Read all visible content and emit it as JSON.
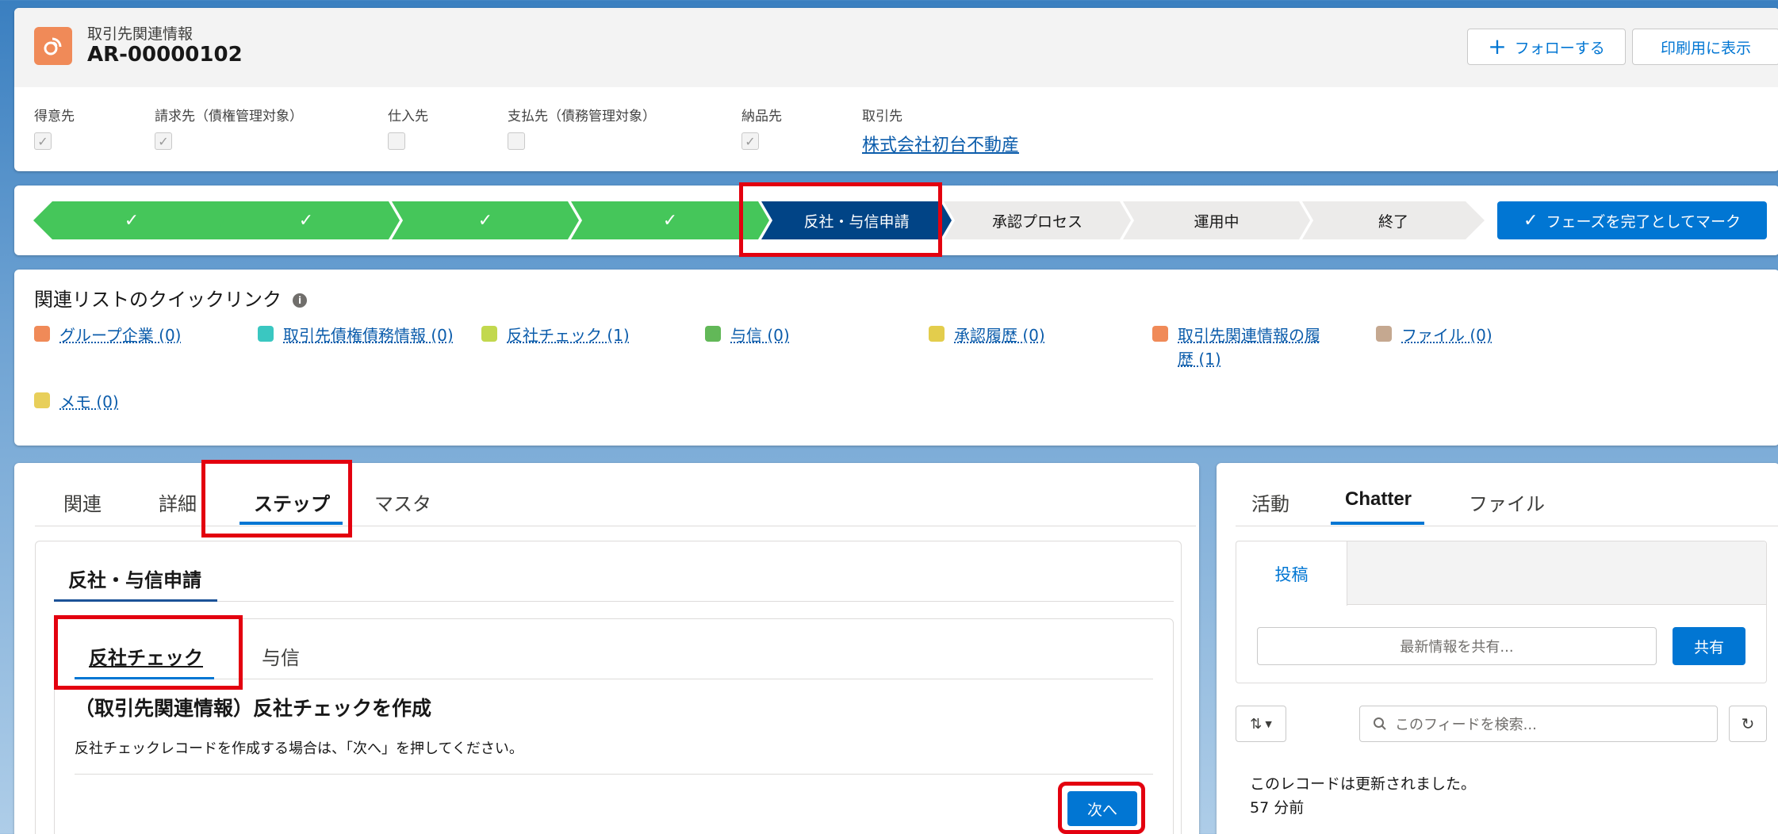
{
  "header": {
    "object_label": "取引先関連情報",
    "record_title": "AR-00000102",
    "follow_label": "フォローする",
    "print_label": "印刷用に表示",
    "fields": [
      {
        "label": "得意先",
        "checked": true
      },
      {
        "label": "請求先（債権管理対象）",
        "checked": true
      },
      {
        "label": "仕入先",
        "checked": false
      },
      {
        "label": "支払先（債務管理対象）",
        "checked": false
      },
      {
        "label": "納品先",
        "checked": true
      }
    ],
    "account_label": "取引先",
    "account_value": "株式会社初台不動産"
  },
  "path": {
    "completed_count": 4,
    "current": "反社・与信申請",
    "upcoming": [
      "承認プロセス",
      "運用中",
      "終了"
    ],
    "mark_complete_label": "フェーズを完了としてマーク"
  },
  "quick_links": {
    "title": "関連リストのクイックリンク",
    "items": [
      {
        "label": "グループ企業 (0)",
        "color": "#f08a58"
      },
      {
        "label": "取引先債権債務情報 (0)",
        "color": "#3ac7c1"
      },
      {
        "label": "反社チェック (1)",
        "color": "#c2d84e"
      },
      {
        "label": "与信 (0)",
        "color": "#62b858"
      },
      {
        "label": "承認履歴 (0)",
        "color": "#e3cd4c"
      },
      {
        "label": "取引先関連情報の履",
        "label2": "歴 (1)",
        "color": "#f08a58"
      },
      {
        "label": "ファイル (0)",
        "color": "#c5a890"
      },
      {
        "label": "メモ (0)",
        "color": "#e8cf5a"
      }
    ]
  },
  "main_tabs": [
    "関連",
    "詳細",
    "ステップ",
    "マスタ"
  ],
  "step_section": {
    "title": "反社・与信申請",
    "subtabs": [
      "反社チェック",
      "与信"
    ],
    "heading": "（取引先関連情報）反社チェックを作成",
    "description": "反社チェックレコードを作成する場合は、「次へ」を押してください。",
    "next_label": "次へ"
  },
  "side_tabs": [
    "活動",
    "Chatter",
    "ファイル"
  ],
  "chatter": {
    "post_tab": "投稿",
    "share_placeholder": "最新情報を共有...",
    "share_button": "共有",
    "search_placeholder": "このフィードを検索...",
    "feed_text": "このレコードは更新されました。",
    "feed_time": "57 分前"
  }
}
